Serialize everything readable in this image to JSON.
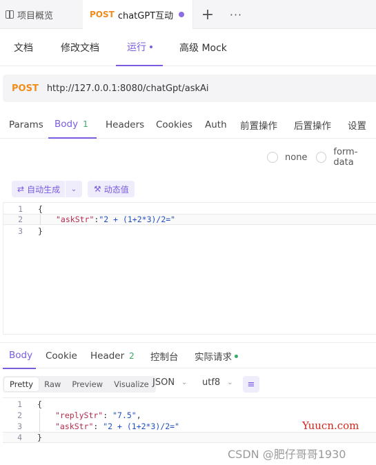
{
  "tabbar": {
    "overview_label": "项目概览",
    "active_tab": {
      "method": "POST",
      "title": "chatGPT互动"
    },
    "add_symbol": "+",
    "more_symbol": "···"
  },
  "subnav": {
    "items": [
      "文档",
      "修改文档",
      "运行",
      "高级 Mock"
    ],
    "active": "运行"
  },
  "request": {
    "method": "POST",
    "url": "http://127.0.0.1:8080/chatGpt/askAi",
    "tabs": [
      {
        "label": "Params"
      },
      {
        "label": "Body",
        "badge": "1"
      },
      {
        "label": "Headers"
      },
      {
        "label": "Cookies"
      },
      {
        "label": "Auth"
      },
      {
        "label": "前置操作"
      },
      {
        "label": "后置操作"
      },
      {
        "label": "设置"
      }
    ],
    "body_types": [
      "none",
      "form-data"
    ],
    "auto_generate_label": "自动生成",
    "dynamic_value_label": "动态值",
    "body_lines": [
      {
        "num": "1",
        "text": "{"
      },
      {
        "num": "2",
        "key": "\"askStr\"",
        "sep": ":",
        "value": "\"2 + (1+2*3)/2=\""
      },
      {
        "num": "3",
        "text": "}"
      }
    ]
  },
  "response": {
    "tabs": [
      {
        "label": "Body"
      },
      {
        "label": "Cookie"
      },
      {
        "label": "Header",
        "badge": "2"
      },
      {
        "label": "控制台"
      },
      {
        "label": "实际请求"
      }
    ],
    "view_modes": [
      "Pretty",
      "Raw",
      "Preview",
      "Visualize"
    ],
    "format": "JSON",
    "encoding": "utf8",
    "body_lines": [
      {
        "num": "1",
        "text": "{"
      },
      {
        "num": "2",
        "key": "\"replyStr\"",
        "sep": ": ",
        "value": "\"7.5\"",
        "trail": ","
      },
      {
        "num": "3",
        "key": "\"askStr\"",
        "sep": ": ",
        "value": "\"2 + (1+2*3)/2=\""
      },
      {
        "num": "4",
        "text": "}"
      }
    ]
  },
  "watermarks": {
    "site": "Yuucn.com",
    "csdn": "CSDN @肥仔哥哥1930"
  },
  "colors": {
    "accent": "#7a5be0",
    "method_post": "#f08c1c",
    "success": "#3aa867"
  }
}
